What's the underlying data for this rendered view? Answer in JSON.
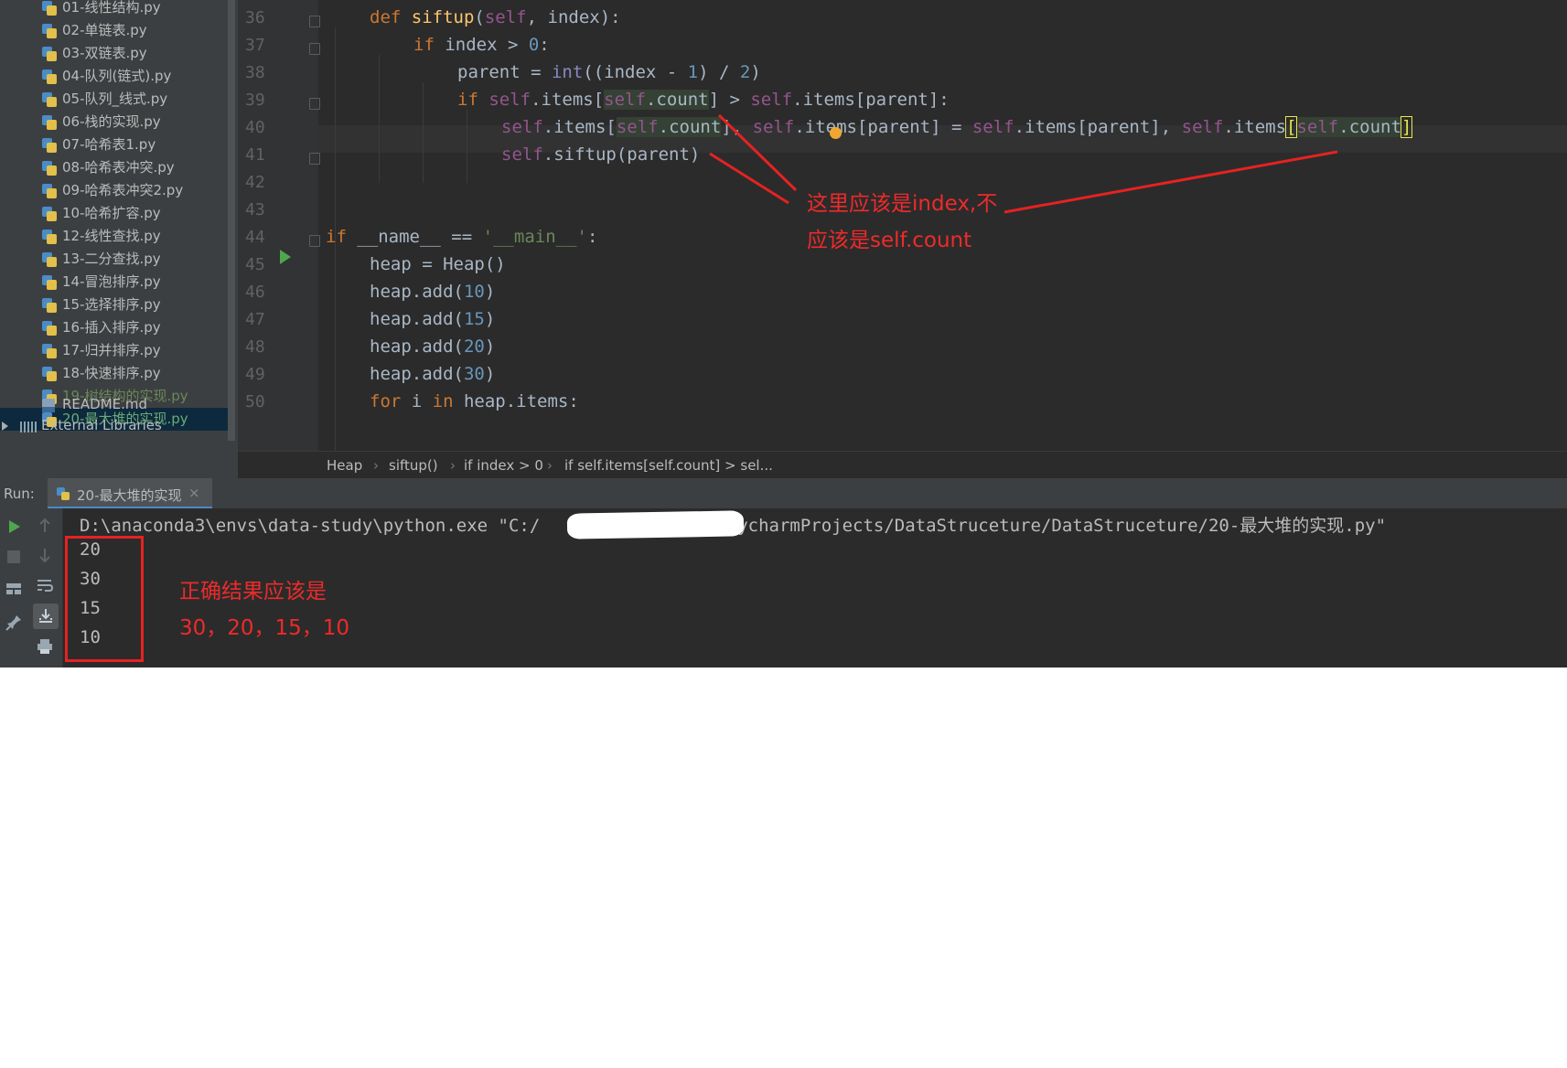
{
  "project_tree": {
    "items": [
      {
        "label": "01-线性结构.py",
        "state": "normal"
      },
      {
        "label": "02-单链表.py",
        "state": "normal"
      },
      {
        "label": "03-双链表.py",
        "state": "normal"
      },
      {
        "label": "04-队列(链式).py",
        "state": "normal"
      },
      {
        "label": "05-队列_线式.py",
        "state": "normal"
      },
      {
        "label": "06-栈的实现.py",
        "state": "normal"
      },
      {
        "label": "07-哈希表1.py",
        "state": "normal"
      },
      {
        "label": "08-哈希表冲突.py",
        "state": "normal"
      },
      {
        "label": "09-哈希表冲突2.py",
        "state": "normal"
      },
      {
        "label": "10-哈希扩容.py",
        "state": "normal"
      },
      {
        "label": "12-线性查找.py",
        "state": "normal"
      },
      {
        "label": "13-二分查找.py",
        "state": "normal"
      },
      {
        "label": "14-冒泡排序.py",
        "state": "normal"
      },
      {
        "label": "15-选择排序.py",
        "state": "normal"
      },
      {
        "label": "16-插入排序.py",
        "state": "normal"
      },
      {
        "label": "17-归并排序.py",
        "state": "normal"
      },
      {
        "label": "18-快速排序.py",
        "state": "normal"
      },
      {
        "label": "19-树结构的实现.py",
        "state": "modified"
      },
      {
        "label": "20-最大堆的实现.py",
        "state": "selected"
      }
    ],
    "readme": "README.md",
    "external_libraries": "External Libraries"
  },
  "editor": {
    "line_numbers": [
      "36",
      "37",
      "38",
      "39",
      "40",
      "41",
      "42",
      "43",
      "44",
      "45",
      "46",
      "47",
      "48",
      "49",
      "50"
    ],
    "code": {
      "l36": {
        "def": "def ",
        "name": "siftup",
        "open": "(",
        "self": "self",
        "rest": ", index):"
      },
      "l37": {
        "kw": "if",
        "rest": " index > ",
        "zero": "0",
        "colon": ":"
      },
      "l38": {
        "a": "parent = ",
        "int": "int",
        "b": "((index - ",
        "one": "1",
        "c": ") / ",
        "two": "2",
        "d": ")"
      },
      "l39": {
        "kw": "if ",
        "s1": "self",
        "a": ".items[",
        "s2": "self",
        "dot": ".",
        "count": "count",
        "b": "] > ",
        "s3": "self",
        "c": ".items[parent]:"
      },
      "l40": {
        "s1": "self",
        "a": ".items[",
        "s2": "self",
        "dot": ".",
        "count": "count",
        "b": "], ",
        "s3": "self",
        "c": ".items[parent] = ",
        "s4": "self",
        "d": ".items[parent], ",
        "s5": "self",
        "e": ".items",
        "lb": "[",
        "s6": "self",
        "f": ".count",
        "rb": "]"
      },
      "l41": {
        "s1": "self",
        "a": ".siftup(parent)"
      },
      "l44": {
        "kw": "if",
        "a": " __name__ == ",
        "str": "'__main__'",
        "b": ":"
      },
      "l45": {
        "a": "heap = Heap()"
      },
      "l46": {
        "a": "heap.add(",
        "n": "10",
        "b": ")"
      },
      "l47": {
        "a": "heap.add(",
        "n": "15",
        "b": ")"
      },
      "l48": {
        "a": "heap.add(",
        "n": "20",
        "b": ")"
      },
      "l49": {
        "a": "heap.add(",
        "n": "30",
        "b": ")"
      },
      "l50": {
        "kw1": "for",
        "a": " i ",
        "kw2": "in",
        "b": " heap.items:"
      }
    }
  },
  "breadcrumb": [
    "Heap",
    "siftup()",
    "if index > 0",
    "if self.items[self.count] > sel..."
  ],
  "run": {
    "label": "Run:",
    "tab_label": "20-最大堆的实现",
    "close": "×",
    "command_prefix": "D:\\anaconda3\\envs\\data-study\\python.exe \"C:/",
    "command_suffix": "/PycharmProjects/DataStruceture/DataStruceture/20-最大堆的实现.py\"",
    "output": [
      "20",
      "30",
      "15",
      "10"
    ]
  },
  "annotations": {
    "note1_line1": "这里应该是index,不",
    "note1_line2": "应该是self.count",
    "note2_line1": "正确结果应该是",
    "note2_line2": "30，20，15，10"
  },
  "colors": {
    "keyword": "#cc7832",
    "self": "#94558d",
    "number": "#6897bb",
    "function": "#ffc66d",
    "annotation_red": "#ee2a2a"
  }
}
